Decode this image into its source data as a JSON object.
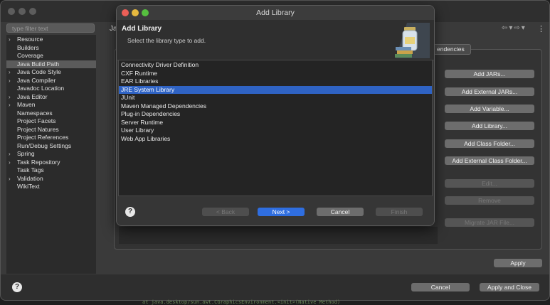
{
  "properties_window": {
    "filter_placeholder": "type filter text",
    "page_title": "Ja",
    "nav_arrows": "⇦▾⇨▾",
    "menu_icon": "⋮",
    "tab_label": "endencies",
    "tree": [
      {
        "label": "Resource",
        "expandable": true
      },
      {
        "label": "Builders",
        "expandable": false
      },
      {
        "label": "Coverage",
        "expandable": false
      },
      {
        "label": "Java Build Path",
        "expandable": false,
        "selected": true
      },
      {
        "label": "Java Code Style",
        "expandable": true
      },
      {
        "label": "Java Compiler",
        "expandable": true
      },
      {
        "label": "Javadoc Location",
        "expandable": false
      },
      {
        "label": "Java Editor",
        "expandable": true
      },
      {
        "label": "Maven",
        "expandable": true
      },
      {
        "label": "Namespaces",
        "expandable": false
      },
      {
        "label": "Project Facets",
        "expandable": false
      },
      {
        "label": "Project Natures",
        "expandable": false
      },
      {
        "label": "Project References",
        "expandable": false
      },
      {
        "label": "Run/Debug Settings",
        "expandable": false
      },
      {
        "label": "Spring",
        "expandable": true
      },
      {
        "label": "Task Repository",
        "expandable": true
      },
      {
        "label": "Task Tags",
        "expandable": false
      },
      {
        "label": "Validation",
        "expandable": true
      },
      {
        "label": "WikiText",
        "expandable": false
      }
    ],
    "side_buttons": [
      {
        "label": "Add JARs...",
        "enabled": true
      },
      {
        "label": "Add External JARs...",
        "enabled": true
      },
      {
        "label": "Add Variable...",
        "enabled": true
      },
      {
        "label": "Add Library...",
        "enabled": true
      },
      {
        "label": "Add Class Folder...",
        "enabled": true
      },
      {
        "label": "Add External Class Folder...",
        "enabled": true
      },
      {
        "label": "Edit...",
        "enabled": false
      },
      {
        "label": "Remove",
        "enabled": false
      },
      {
        "label": "Migrate JAR File...",
        "enabled": false
      }
    ],
    "apply_label": "Apply",
    "help_symbol": "?",
    "cancel_label": "Cancel",
    "apply_close_label": "Apply and Close",
    "code_line": "at java.desktop/sun.awt.CGraphicsEnvironment.<init>(Native Method)"
  },
  "dialog": {
    "title": "Add Library",
    "heading": "Add Library",
    "subtitle": "Select the library type to add.",
    "items": [
      {
        "label": "Connectivity Driver Definition"
      },
      {
        "label": "CXF Runtime"
      },
      {
        "label": "EAR Libraries"
      },
      {
        "label": "JRE System Library",
        "selected": true
      },
      {
        "label": "JUnit"
      },
      {
        "label": "Maven Managed Dependencies"
      },
      {
        "label": "Plug-in Dependencies"
      },
      {
        "label": "Server Runtime"
      },
      {
        "label": "User Library"
      },
      {
        "label": "Web App Libraries"
      }
    ],
    "help_symbol": "?",
    "back_label": "< Back",
    "next_label": "Next >",
    "cancel_label": "Cancel",
    "finish_label": "Finish"
  },
  "colors": {
    "selection": "#2f63c4",
    "primary_button": "#2f6ee0",
    "traffic_red": "#ec5f57",
    "traffic_yellow": "#e6b93f",
    "traffic_green": "#56c03f"
  }
}
